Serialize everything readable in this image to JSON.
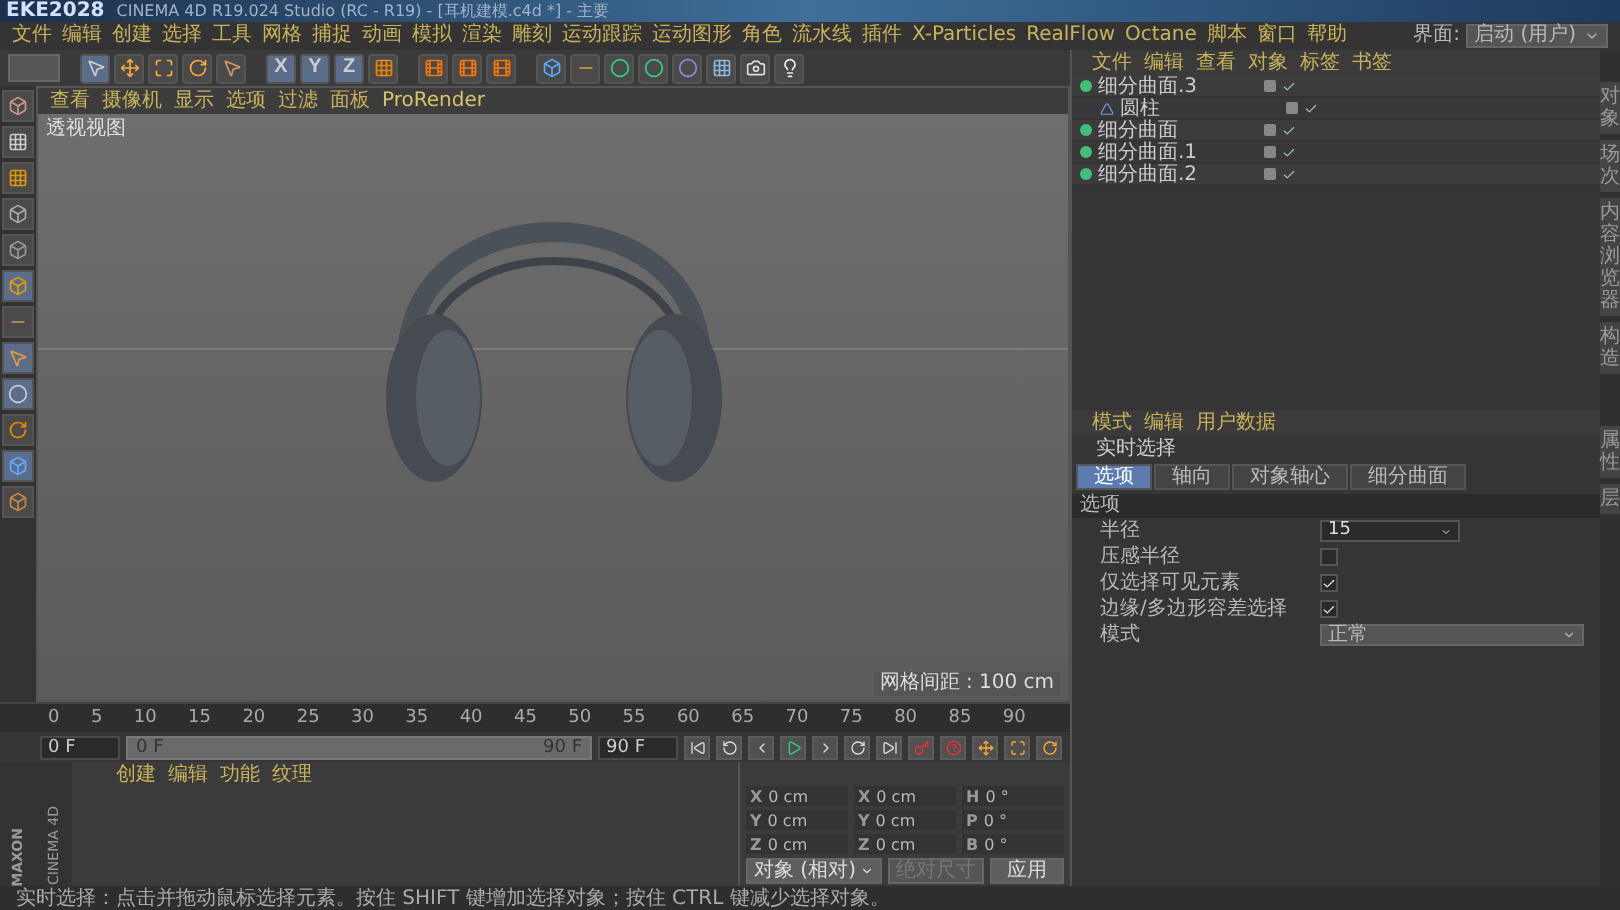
{
  "title_bar": {
    "logo": "EKE2028",
    "title": "CINEMA 4D R19.024 Studio (RC - R19) - [耳机建模.c4d *] - 主要"
  },
  "menu": [
    "文件",
    "编辑",
    "创建",
    "选择",
    "工具",
    "网格",
    "捕捉",
    "动画",
    "模拟",
    "渲染",
    "雕刻",
    "运动跟踪",
    "运动图形",
    "角色",
    "流水线",
    "插件",
    "X-Particles",
    "RealFlow",
    "Octane",
    "脚本",
    "窗口",
    "帮助"
  ],
  "layout": {
    "label": "界面:",
    "value": "启动 (用户)"
  },
  "axis_buttons": [
    "X",
    "Y",
    "Z"
  ],
  "viewport": {
    "menu": [
      "查看",
      "摄像机",
      "显示",
      "选项",
      "过滤",
      "面板",
      "ProRender"
    ],
    "label": "透视视图",
    "grid_spacing": "网格间距 : 100 cm"
  },
  "objects": {
    "menu": [
      "文件",
      "编辑",
      "查看",
      "对象",
      "标签",
      "书签"
    ],
    "items": [
      {
        "name": "细分曲面.3",
        "children": [
          {
            "name": "圆柱"
          }
        ]
      },
      {
        "name": "细分曲面"
      },
      {
        "name": "细分曲面.1"
      },
      {
        "name": "细分曲面.2"
      }
    ]
  },
  "side_tabs": [
    "对象",
    "场次",
    "内容浏览器",
    "构造"
  ],
  "attributes": {
    "menu": [
      "模式",
      "编辑",
      "用户数据"
    ],
    "tool": "实时选择",
    "tabs": [
      {
        "label": "选项",
        "selected": true
      },
      {
        "label": "轴向",
        "selected": false
      },
      {
        "label": "对象轴心",
        "selected": false
      },
      {
        "label": "细分曲面",
        "selected": false
      }
    ],
    "section": "选项",
    "rows": [
      {
        "kind": "number",
        "label": "半径",
        "value": "15"
      },
      {
        "kind": "checkbox",
        "label": "压感半径",
        "checked": false
      },
      {
        "kind": "checkbox",
        "label": "仅选择可见元素",
        "checked": true
      },
      {
        "kind": "checkbox",
        "label": "边缘/多边形容差选择",
        "checked": true
      },
      {
        "kind": "select",
        "label": "模式",
        "value": "正常"
      }
    ]
  },
  "attr_side_tabs": [
    "属性",
    "层"
  ],
  "timeline": {
    "ticks": [
      "0",
      "5",
      "10",
      "15",
      "20",
      "25",
      "30",
      "35",
      "40",
      "45",
      "50",
      "55",
      "60",
      "65",
      "70",
      "75",
      "80",
      "85",
      "90"
    ],
    "current_frame": "0 F",
    "slider": {
      "start": "0 F",
      "end": "90 F",
      "level": 1
    },
    "end_frame": "90 F"
  },
  "materials": {
    "menu": [
      "创建",
      "编辑",
      "功能",
      "纹理"
    ]
  },
  "coordinates": {
    "columns": [
      [
        {
          "axis": "X",
          "value": "0 cm"
        },
        {
          "axis": "Y",
          "value": "0 cm"
        },
        {
          "axis": "Z",
          "value": "0 cm"
        }
      ],
      [
        {
          "axis": "X",
          "value": "0 cm"
        },
        {
          "axis": "Y",
          "value": "0 cm"
        },
        {
          "axis": "Z",
          "value": "0 cm"
        }
      ],
      [
        {
          "axis": "H",
          "value": "0 °"
        },
        {
          "axis": "P",
          "value": "0 °"
        },
        {
          "axis": "B",
          "value": "0 °"
        }
      ]
    ],
    "mode": "对象 (相对)",
    "size_mode": "绝对尺寸",
    "apply": "应用"
  },
  "brand": {
    "top": "MAXON",
    "bottom": "CINEMA 4D"
  },
  "status_bar": "实时选择：点击并拖动鼠标选择元素。按住 SHIFT 键增加选择对象；按住 CTRL 键减少选择对象。"
}
